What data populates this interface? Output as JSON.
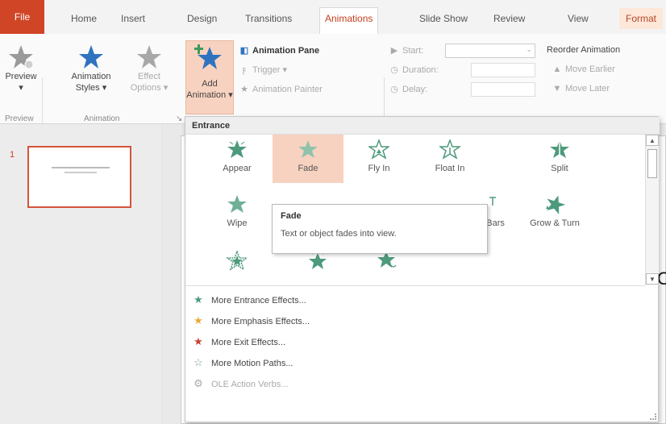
{
  "tabs": {
    "file": "File",
    "home": "Home",
    "insert": "Insert",
    "design": "Design",
    "transitions": "Transitions",
    "animations": "Animations",
    "slideshow": "Slide Show",
    "review": "Review",
    "view": "View",
    "format": "Format"
  },
  "ribbon": {
    "preview_label": "Preview",
    "preview_arrow": "▾",
    "animation_styles_line1": "Animation",
    "animation_styles_line2": "Styles ▾",
    "effect_options_line1": "Effect",
    "effect_options_line2": "Options ▾",
    "add_animation_line1": "Add",
    "add_animation_line2": "Animation ▾",
    "animation_pane": "Animation Pane",
    "trigger": "Trigger ▾",
    "animation_painter": "Animation Painter",
    "start_label": "Start:",
    "duration_label": "Duration:",
    "delay_label": "Delay:",
    "reorder_title": "Reorder Animation",
    "move_earlier": "Move Earlier",
    "move_later": "Move Later",
    "group_preview": "Preview",
    "group_animation": "Animation"
  },
  "slides": {
    "number": "1"
  },
  "dropdown": {
    "header": "Entrance",
    "effects": [
      {
        "label": "Appear",
        "icon": "appear-star-icon"
      },
      {
        "label": "Fade",
        "icon": "fade-star-icon"
      },
      {
        "label": "Fly In",
        "icon": "fly-in-star-icon"
      },
      {
        "label": "Float In",
        "icon": "float-in-star-icon"
      },
      {
        "label": "Split",
        "icon": "split-star-icon"
      },
      {
        "label": "Wipe",
        "icon": "wipe-star-icon"
      },
      {
        "label": "n Bars",
        "icon": "bars-star-icon"
      },
      {
        "label": "Grow & Turn",
        "icon": "grow-turn-star-icon"
      }
    ],
    "more_items": [
      {
        "label": "More Entrance Effects...",
        "color": "#4e9a7c"
      },
      {
        "label": "More Emphasis Effects...",
        "color": "#e8a93a"
      },
      {
        "label": "More Exit Effects...",
        "color": "#c8432b"
      },
      {
        "label": "More Motion Paths...",
        "color": "#7a9a8c"
      },
      {
        "label": "OLE Action Verbs...",
        "color": "#aaaaaa"
      }
    ]
  },
  "tooltip": {
    "title": "Fade",
    "description": "Text or object fades into view."
  },
  "colors": {
    "accent": "#c43e1c",
    "entrance_green": "#4e9a7c",
    "selected_bg": "#f8d2c0"
  }
}
